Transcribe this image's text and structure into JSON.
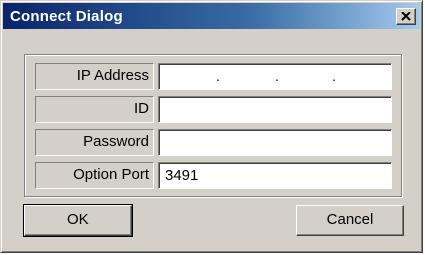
{
  "window": {
    "title": "Connect Dialog",
    "close_symbol": "×",
    "accent_color": "#0a246a"
  },
  "form": {
    "fields": [
      {
        "label": "IP Address",
        "value": "",
        "type": "ip-address",
        "separators": [
          ".",
          ".",
          "."
        ]
      },
      {
        "label": "ID",
        "value": ""
      },
      {
        "label": "Password",
        "value": ""
      },
      {
        "label": "Option Port",
        "value": "3491"
      }
    ]
  },
  "buttons": {
    "ok_label": "OK",
    "cancel_label": "Cancel"
  }
}
